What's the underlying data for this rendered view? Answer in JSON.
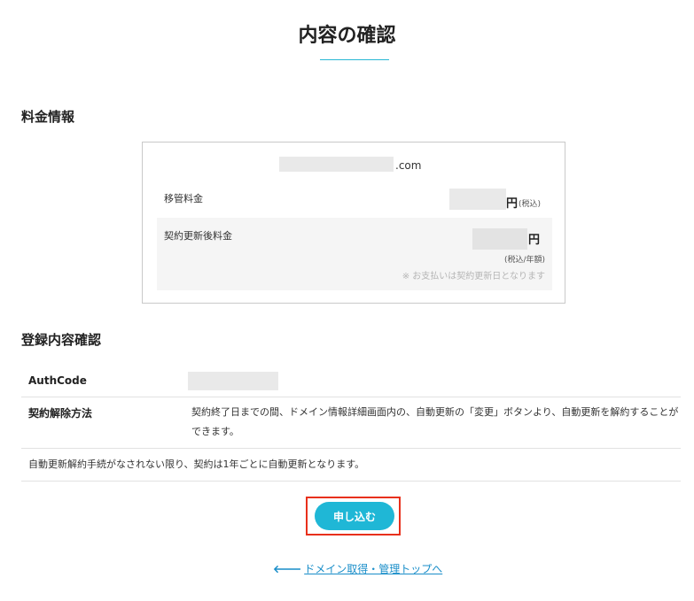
{
  "page": {
    "title": "内容の確認"
  },
  "pricing": {
    "heading": "料金情報",
    "domain_suffix": ".com",
    "transfer_fee_label": "移管料金",
    "transfer_fee_unit": "円",
    "tax_included": "(税込)",
    "renewal_fee_label": "契約更新後料金",
    "renewal_fee_unit": "円",
    "renewal_fee_period": "(税込/年額)",
    "payment_note": "※ お支払いは契約更新日となります"
  },
  "registration": {
    "heading": "登録内容確認",
    "authcode_label": "AuthCode",
    "cancel_method_label": "契約解除方法",
    "cancel_method_text": "契約終了日までの間、ドメイン情報詳細画面内の、自動更新の「変更」ボタンより、自動更新を解約することができます。",
    "auto_renew_notice": "自動更新解約手続がなされない限り、契約は1年ごとに自動更新となります。"
  },
  "actions": {
    "apply_label": "申し込む",
    "back_link_label": "ドメイン取得・管理トップへ",
    "back_icon": "arrow-left-icon"
  },
  "colors": {
    "accent": "#1fb7d6",
    "highlight": "#e8301c",
    "link": "#1a8ec9"
  }
}
